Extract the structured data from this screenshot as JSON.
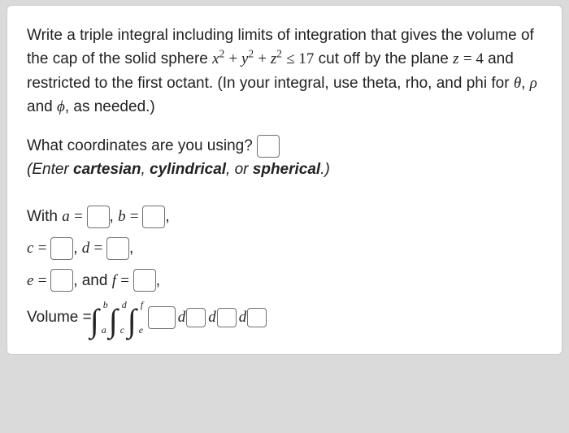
{
  "problem": {
    "line1_pre": "Write a triple integral including limits of integration that gives the volume of the cap of the solid sphere ",
    "sphere_lhs_x": "x",
    "sphere_lhs_y": "y",
    "sphere_lhs_z": "z",
    "exp2": "2",
    "plus": " + ",
    "leq": " ≤ ",
    "sphere_rhs": "17",
    "line1_post": " cut off by the plane ",
    "plane_var": "z",
    "plane_eq": " = ",
    "plane_val": "4",
    "line1_tail": " and restricted to the first octant. (In your integral, use theta, rho, and phi for ",
    "theta": "θ",
    "comma_sp": ", ",
    "rho": "ρ",
    "and_sp": " and ",
    "phi": "ϕ",
    "as_needed": ", as needed.)"
  },
  "coords": {
    "question": "What coordinates are you using? ",
    "hint_pre": "(Enter ",
    "opt1": "cartesian",
    "sep1": ", ",
    "opt2": "cylindrical",
    "sep2": ", or ",
    "opt3": "spherical",
    "hint_post": ".)"
  },
  "limits": {
    "with": "With ",
    "a": "a",
    "b": "b",
    "c": "c",
    "d": "d",
    "e": "e",
    "f": "f",
    "eq": " = ",
    "comma": ", ",
    "and": ", and "
  },
  "volume": {
    "label": "Volume = ",
    "int1_top": "b",
    "int1_bot": "a",
    "int2_top": "d",
    "int2_bot": "c",
    "int3_top": "f",
    "int3_bot": "e",
    "d": "d"
  }
}
